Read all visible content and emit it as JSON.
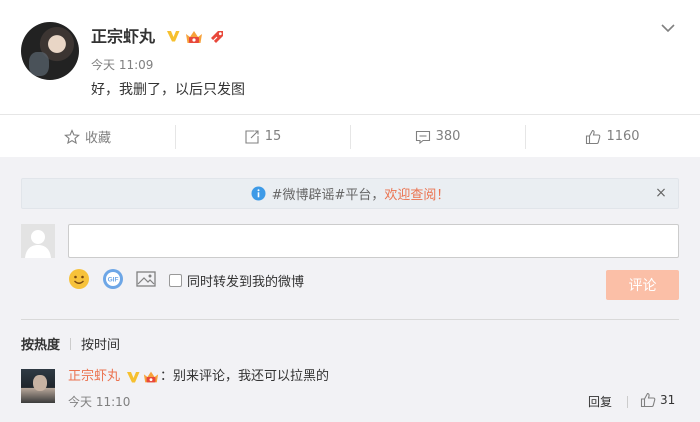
{
  "post": {
    "author": "正宗虾丸",
    "time": "今天 11:09",
    "text": "好，我删了，以后只发图",
    "icons": {
      "verified": "verified-v-icon",
      "member": "crown-member-icon",
      "tag": "badge-tag-icon",
      "menu": "chevron-down-icon"
    }
  },
  "actions": {
    "favorite": {
      "label": "收藏",
      "icon": "star-icon"
    },
    "repost": {
      "label": "15",
      "icon": "repost-icon"
    },
    "comment": {
      "label": "380",
      "icon": "comment-icon"
    },
    "like": {
      "label": "1160",
      "icon": "thumbs-up-icon"
    }
  },
  "notice": {
    "text_prefix": "#微博辟谣#平台，",
    "text_highlight": "欢迎查阅！",
    "close": "×"
  },
  "composer": {
    "input_value": "",
    "repost_label": "同时转发到我的微博",
    "submit_label": "评论",
    "tools": [
      "emoji-icon",
      "gif-icon",
      "image-icon"
    ]
  },
  "sort": {
    "hot": "按热度",
    "time": "按时间"
  },
  "comments": [
    {
      "author": "正宗虾丸",
      "text": "：别来评论，我还可以拉黑的",
      "time": "今天 11:10",
      "reply": "回复",
      "likes": "31"
    }
  ],
  "colors": {
    "accent": "#eb7350",
    "submit_disabled": "#fbbfa7",
    "verified_gold": "#f6c02f",
    "link_blue": "#3d9ae7"
  }
}
